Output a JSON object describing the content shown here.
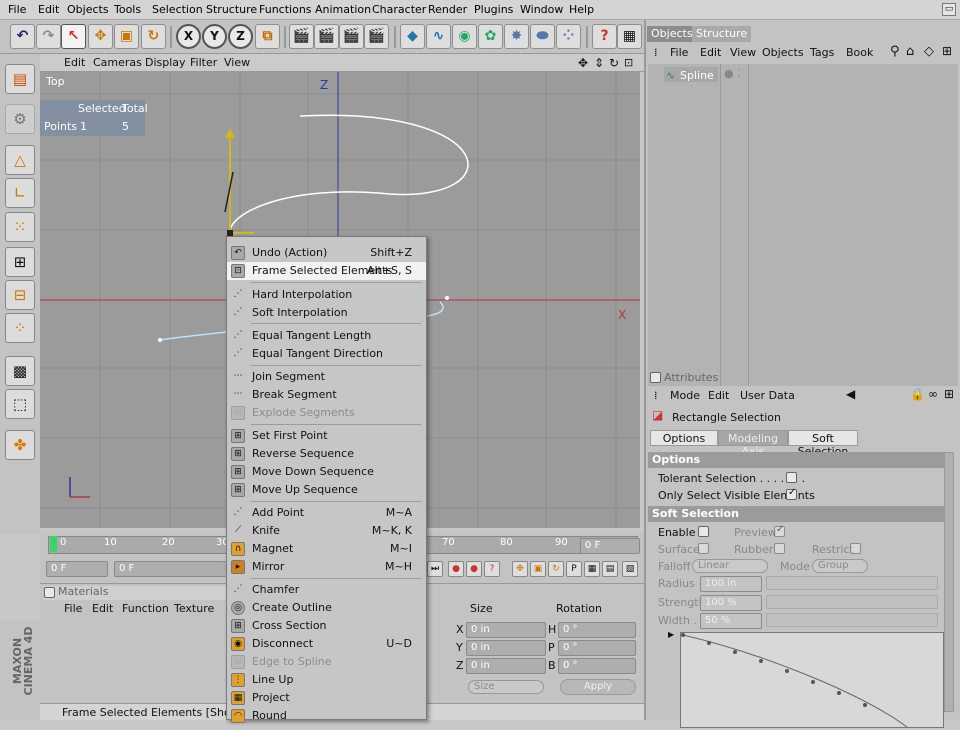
{
  "menubar": {
    "items": [
      "File",
      "Edit",
      "Objects",
      "Tools",
      "Selection",
      "Structure",
      "Functions",
      "Animation",
      "Character",
      "Render",
      "Plugins",
      "Window",
      "Help"
    ]
  },
  "viewport": {
    "menu": [
      "Edit",
      "Cameras",
      "Display",
      "Filter",
      "View"
    ],
    "name": "Top",
    "hud": {
      "header_selected": "Selected",
      "header_total": "Total",
      "row_label": "Points",
      "selected": "1",
      "total": "5"
    },
    "axis_z": "Z",
    "axis_x": "X"
  },
  "timeline": {
    "ticks": [
      "0",
      "10",
      "20",
      "30",
      "70",
      "80",
      "90"
    ],
    "current": "0 F",
    "start": "0 F",
    "end_right": "0 F",
    "field2": "0 F"
  },
  "materials": {
    "title": "Materials",
    "menu": [
      "File",
      "Edit",
      "Function",
      "Texture"
    ]
  },
  "coords": {
    "size_label": "Size",
    "rotation_label": "Rotation",
    "rows": [
      {
        "axis_s": "X",
        "size": "0 in",
        "axis_r": "H",
        "rot": "0 °"
      },
      {
        "axis_s": "Y",
        "size": "0 in",
        "axis_r": "P",
        "rot": "0 °"
      },
      {
        "axis_s": "Z",
        "size": "0 in",
        "axis_r": "B",
        "rot": "0 °"
      }
    ],
    "size_dd": "Size",
    "apply": "Apply"
  },
  "status": "Frame Selected Elements [Shortcut A",
  "brand": {
    "line1": "MAXON",
    "line2": "CINEMA 4D"
  },
  "objects": {
    "tabs": [
      "Objects",
      "Structure"
    ],
    "menu": [
      "File",
      "Edit",
      "View",
      "Objects",
      "Tags",
      "Book"
    ],
    "item": "Spline"
  },
  "attributes": {
    "title": "Attributes",
    "menu": [
      "Mode",
      "Edit",
      "User Data"
    ],
    "tool": "Rectangle Selection",
    "tabs": [
      "Options",
      "Modeling Axis",
      "Soft Selection"
    ],
    "options_head": "Options",
    "tolerant": "Tolerant Selection . . . . . . .",
    "visible": "Only Select Visible Elements",
    "soft_head": "Soft Selection",
    "enable": "Enable",
    "preview": "Preview",
    "surface": "Surface",
    "rubber": "Rubber",
    "restrict": "Restrict",
    "falloff": "Falloff",
    "falloff_val": "Linear",
    "mode": "Mode",
    "mode_val": "Group",
    "radius": "Radius",
    "radius_val": "100 in",
    "strength": "Strength",
    "strength_val": "100 %",
    "width": "Width . .",
    "width_val": "50 %"
  },
  "context_menu": {
    "items": [
      {
        "label": "Undo (Action)",
        "shortcut": "Shift+Z"
      },
      {
        "label": "Frame Selected Elements",
        "shortcut": "Alt+S, S"
      },
      {
        "label": "Hard Interpolation",
        "shortcut": ""
      },
      {
        "label": "Soft Interpolation",
        "shortcut": ""
      },
      {
        "label": "Equal Tangent Length",
        "shortcut": ""
      },
      {
        "label": "Equal Tangent Direction",
        "shortcut": ""
      },
      {
        "label": "Join Segment",
        "shortcut": ""
      },
      {
        "label": "Break Segment",
        "shortcut": ""
      },
      {
        "label": "Explode Segments",
        "shortcut": ""
      },
      {
        "label": "Set First Point",
        "shortcut": ""
      },
      {
        "label": "Reverse Sequence",
        "shortcut": ""
      },
      {
        "label": "Move Down Sequence",
        "shortcut": ""
      },
      {
        "label": "Move Up Sequence",
        "shortcut": ""
      },
      {
        "label": "Add Point",
        "shortcut": "M~A"
      },
      {
        "label": "Knife",
        "shortcut": "M~K, K"
      },
      {
        "label": "Magnet",
        "shortcut": "M~I"
      },
      {
        "label": "Mirror",
        "shortcut": "M~H"
      },
      {
        "label": "Chamfer",
        "shortcut": ""
      },
      {
        "label": "Create Outline",
        "shortcut": ""
      },
      {
        "label": "Cross Section",
        "shortcut": ""
      },
      {
        "label": "Disconnect",
        "shortcut": "U~D"
      },
      {
        "label": "Edge to Spline",
        "shortcut": ""
      },
      {
        "label": "Line Up",
        "shortcut": ""
      },
      {
        "label": "Project",
        "shortcut": ""
      },
      {
        "label": "Round",
        "shortcut": ""
      }
    ]
  },
  "colors": {
    "viewport_bg": "#9b9b9b",
    "spline": "#ffffff",
    "axis_y": "#2f3aa0",
    "axis_x": "#b5333a",
    "highlight_cursor": "#8a3cc8"
  }
}
